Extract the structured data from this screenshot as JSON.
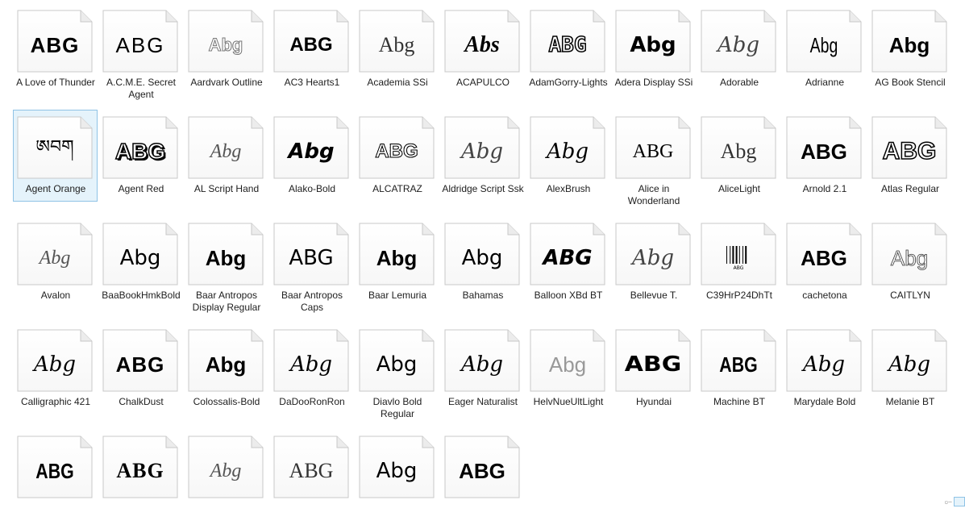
{
  "fonts": [
    {
      "name": "A Love of Thunder",
      "sample": "ABG",
      "style": "stencil-bold"
    },
    {
      "name": "A.C.M.E. Secret Agent",
      "sample": "ABG",
      "style": "typewriter"
    },
    {
      "name": "Aardvark Outline",
      "sample": "Abg",
      "style": "outline"
    },
    {
      "name": "AC3 Hearts1",
      "sample": "ABG",
      "style": "decorative"
    },
    {
      "name": "Academia SSi",
      "sample": "Abg",
      "style": "light-serif"
    },
    {
      "name": "ACAPULCO",
      "sample": "Abs",
      "style": "brush"
    },
    {
      "name": "AdamGorry-Lights",
      "sample": "ABG",
      "style": "lights"
    },
    {
      "name": "Adera Display SSi",
      "sample": "Abg",
      "style": "display-bold"
    },
    {
      "name": "Adorable",
      "sample": "Abg",
      "style": "script-light"
    },
    {
      "name": "Adrianne",
      "sample": "Abg",
      "style": "condensed"
    },
    {
      "name": "AG Book Stencil",
      "sample": "Abg",
      "style": "bold-sans"
    },
    {
      "name": "Agent Orange",
      "sample": "ཨབག",
      "style": "tibetan"
    },
    {
      "name": "Agent Red",
      "sample": "ABG",
      "style": "3d-outline"
    },
    {
      "name": "AL Script Hand",
      "sample": "Abg",
      "style": "script-thin"
    },
    {
      "name": "Alako-Bold",
      "sample": "Abg",
      "style": "bold-italic"
    },
    {
      "name": "ALCATRAZ",
      "sample": "ABG",
      "style": "striped"
    },
    {
      "name": "Aldridge Script Ssk",
      "sample": "Abg",
      "style": "script-light"
    },
    {
      "name": "AlexBrush",
      "sample": "Abg",
      "style": "script"
    },
    {
      "name": "Alice in Wonderland",
      "sample": "ABG",
      "style": "smallcaps-serif"
    },
    {
      "name": "AliceLight",
      "sample": "Abg",
      "style": "light-serif"
    },
    {
      "name": "Arnold 2.1",
      "sample": "ABG",
      "style": "bold-sans"
    },
    {
      "name": "Atlas Regular",
      "sample": "ABG",
      "style": "inline"
    },
    {
      "name": "Avalon",
      "sample": "Abg",
      "style": "script-thin"
    },
    {
      "name": "BaaBookHmkBold",
      "sample": "Abg",
      "style": "sans"
    },
    {
      "name": "Baar  Antropos Display Regular",
      "sample": "Abg",
      "style": "bold-sans"
    },
    {
      "name": "Baar Antropos Caps",
      "sample": "ABG",
      "style": "sans"
    },
    {
      "name": "Baar Lemuria",
      "sample": "Abg",
      "style": "bold-sans"
    },
    {
      "name": "Bahamas",
      "sample": "Abg",
      "style": "sans"
    },
    {
      "name": "Balloon XBd BT",
      "sample": "ABG",
      "style": "bold-italic"
    },
    {
      "name": "Bellevue T.",
      "sample": "Abg",
      "style": "script-light"
    },
    {
      "name": "C39HrP24DhTt",
      "sample": "ABG",
      "style": "barcode"
    },
    {
      "name": "cachetona",
      "sample": "ABG",
      "style": "bold-sans"
    },
    {
      "name": "CAITLYN",
      "sample": "Abg",
      "style": "outline-light"
    },
    {
      "name": "Calligraphic 421",
      "sample": "Abg",
      "style": "calligraphic"
    },
    {
      "name": "ChalkDust",
      "sample": "ABG",
      "style": "chalk"
    },
    {
      "name": "Colossalis-Bold",
      "sample": "Abg",
      "style": "bold-sans"
    },
    {
      "name": "DaDooRonRon",
      "sample": "Abg",
      "style": "script"
    },
    {
      "name": "Diavlo Bold Regular",
      "sample": "Abg",
      "style": "sans"
    },
    {
      "name": "Eager Naturalist",
      "sample": "Abg",
      "style": "hand"
    },
    {
      "name": "HelvNueUltLight",
      "sample": "Abg",
      "style": "ultralight"
    },
    {
      "name": "Hyundai",
      "sample": "ABG",
      "style": "heavy-wide"
    },
    {
      "name": "Machine BT",
      "sample": "ABG",
      "style": "condensed-bold"
    },
    {
      "name": "Marydale Bold",
      "sample": "Abg",
      "style": "hand"
    },
    {
      "name": "Melanie BT",
      "sample": "Abg",
      "style": "script"
    },
    {
      "name": "",
      "sample": "ABG",
      "style": "condensed-bold"
    },
    {
      "name": "",
      "sample": "ABG",
      "style": "bold-serif"
    },
    {
      "name": "",
      "sample": "Abg",
      "style": "script-thin"
    },
    {
      "name": "",
      "sample": "ABG",
      "style": "light-serif"
    },
    {
      "name": "",
      "sample": "Abg",
      "style": "sans"
    },
    {
      "name": "",
      "sample": "ABG",
      "style": "bold-sans"
    }
  ],
  "selected_index": 11,
  "colors": {
    "selection_bg": "#e5f3fb",
    "selection_border": "#8fc3e6",
    "page_fill": "#f7f7f7",
    "page_stroke": "#c8c8c8"
  }
}
